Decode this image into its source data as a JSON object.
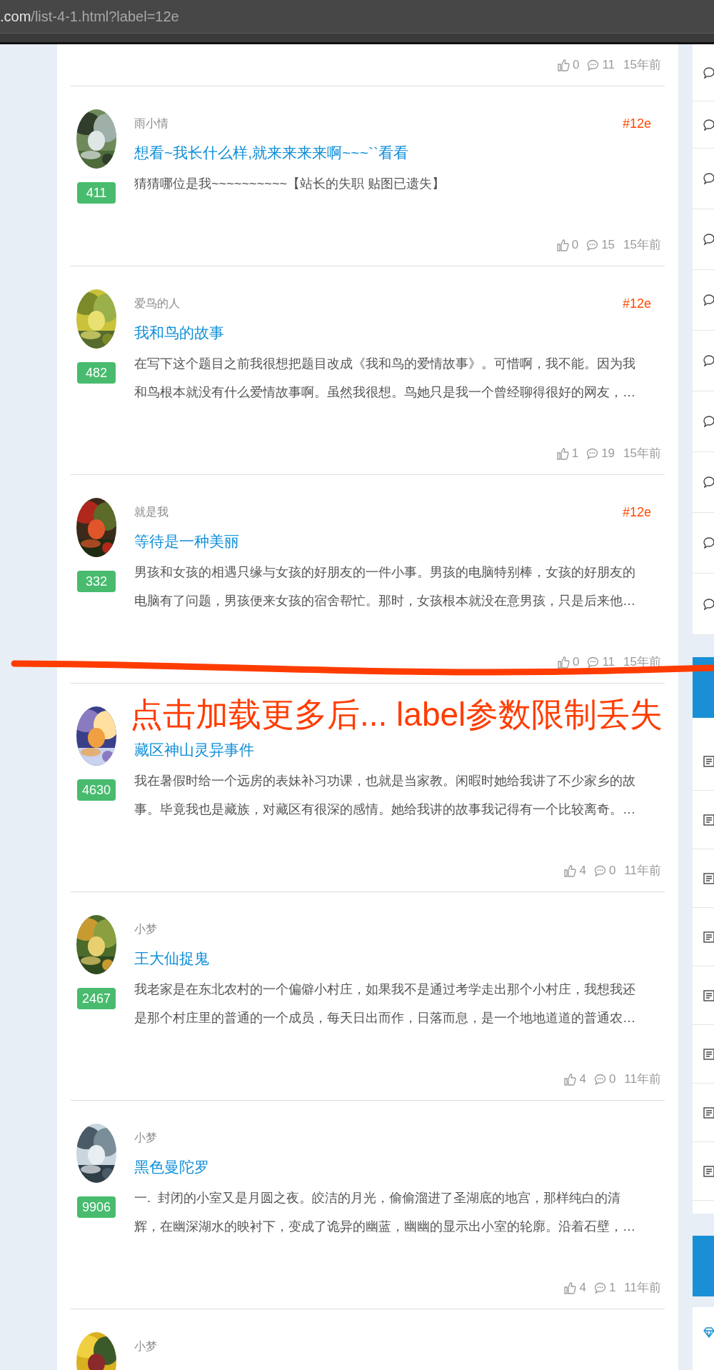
{
  "address_bar": {
    "host": ".com",
    "path": "/list-4-1.html?label=12e"
  },
  "top_footer": {
    "likes": "0",
    "comments": "11",
    "time": "15年前"
  },
  "posts": [
    {
      "author": "雨小情",
      "tag": "#12e",
      "title": "想看~我长什么样,就来来来来啊~~~``看看",
      "excerpt_lines": [
        "猜猜哪位是我~~~~~~~~~~【站长的失职 贴图已遗失】"
      ],
      "score": "411",
      "likes": "0",
      "comments": "15",
      "time": "15年前"
    },
    {
      "author": "爱鸟的人",
      "tag": "#12e",
      "title": "我和鸟的故事",
      "excerpt_lines": [
        "在写下这个题目之前我很想把题目改成《我和鸟的爱情故事》。可惜啊，我不能。因为我",
        "和鸟根本就没有什么爱情故事啊。虽然我很想。鸟她只是我一个曾经聊得很好的网友，…"
      ],
      "score": "482",
      "likes": "1",
      "comments": "19",
      "time": "15年前"
    },
    {
      "author": "就是我",
      "tag": "#12e",
      "title": "等待是一种美丽",
      "excerpt_lines": [
        "男孩和女孩的相遇只缘与女孩的好朋友的一件小事。男孩的电脑特别棒，女孩的好朋友的",
        "电脑有了问题，男孩便来女孩的宿舍帮忙。那时，女孩根本就没在意男孩，只是后来他…"
      ],
      "score": "332",
      "likes": "0",
      "comments": "11",
      "time": "15年前"
    },
    {
      "title": "藏区神山灵异事件",
      "excerpt_lines": [
        "我在暑假时给一个远房的表妹补习功课，也就是当家教。闲暇时她给我讲了不少家乡的故",
        "事。毕竟我也是藏族，对藏区有很深的感情。她给我讲的故事我记得有一个比较离奇。…"
      ],
      "score": "4630",
      "likes": "4",
      "comments": "0",
      "time": "11年前"
    },
    {
      "author": "小梦",
      "title": "王大仙捉鬼",
      "excerpt_lines": [
        "我老家是在东北农村的一个偏僻小村庄，如果我不是通过考学走出那个小村庄，我想我还",
        "是那个村庄里的普通的一个成员，每天日出而作，日落而息，是一个地地道道的普通农…"
      ],
      "score": "2467",
      "likes": "4",
      "comments": "0",
      "time": "11年前"
    },
    {
      "author": "小梦",
      "title": "黑色曼陀罗",
      "excerpt_lines": [
        "一.  封闭的小室又是月圆之夜。皎洁的月光，偷偷溜进了圣湖底的地宫，那样纯白的清",
        "辉，在幽深湖水的映衬下，变成了诡异的幽蓝，幽幽的显示出小室的轮廓。沿着石壁，…"
      ],
      "score": "9906",
      "likes": "4",
      "comments": "1",
      "time": "11年前"
    },
    {
      "author": "小梦"
    }
  ],
  "annotation": {
    "text": "点击加载更多后... label参数限制丢失"
  }
}
